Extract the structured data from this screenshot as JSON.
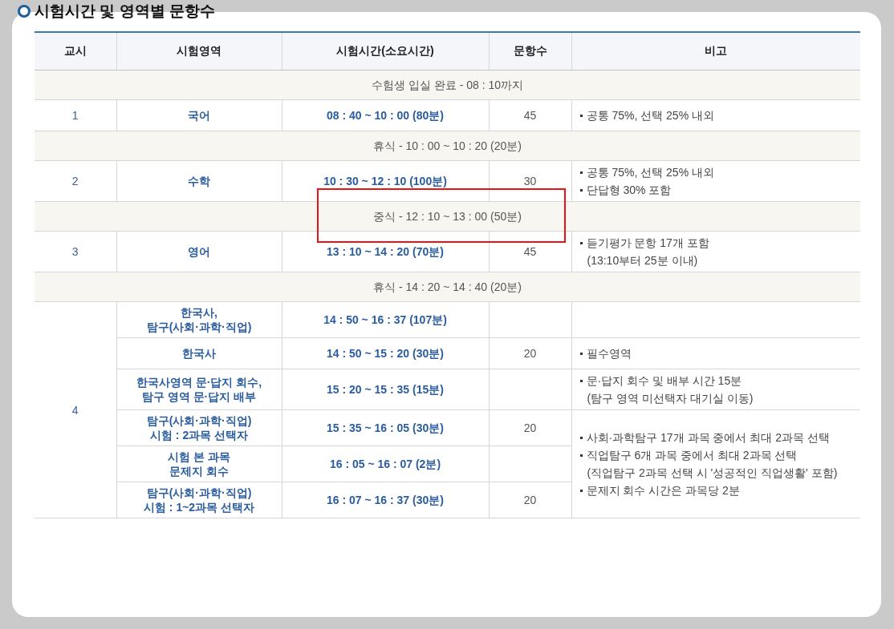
{
  "heading": "시험시간 및 영역별 문항수",
  "columns": [
    "교시",
    "시험영역",
    "시험시간(소요시간)",
    "문항수",
    "비고"
  ],
  "rows": [
    {
      "kind": "break",
      "text": "수험생 입실 완료 - 08 : 10까지",
      "highlighted": false
    },
    {
      "kind": "period",
      "number": "1",
      "sessions": [
        {
          "area": "국어",
          "time": "08 : 40 ~ 10 : 00 (80분)",
          "count": "45",
          "notes": [
            {
              "text": "공통 75%, 선택 25% 내외",
              "bullet": true
            }
          ]
        }
      ]
    },
    {
      "kind": "break",
      "text": "휴식 - 10 : 00 ~ 10 : 20 (20분)",
      "highlighted": false
    },
    {
      "kind": "period",
      "number": "2",
      "sessions": [
        {
          "area": "수학",
          "time": "10 : 30 ~ 12 : 10 (100분)",
          "count": "30",
          "notes": [
            {
              "text": "공통 75%, 선택 25% 내외",
              "bullet": true
            },
            {
              "text": "단답형 30% 포함",
              "bullet": true
            }
          ]
        }
      ]
    },
    {
      "kind": "break",
      "text": "중식 - 12 : 10 ~ 13 : 00 (50분)",
      "highlighted": true
    },
    {
      "kind": "period",
      "number": "3",
      "sessions": [
        {
          "area": "영어",
          "time": "13 : 10 ~ 14 : 20 (70분)",
          "count": "45",
          "notes": [
            {
              "text": "듣기평가 문항 17개 포함",
              "bullet": true
            },
            {
              "text": "(13:10부터 25분 이내)",
              "bullet": false
            }
          ]
        }
      ]
    },
    {
      "kind": "break",
      "text": "휴식 - 14 : 20 ~ 14 : 40 (20분)",
      "highlighted": false
    },
    {
      "kind": "period",
      "number": "4",
      "sessions": [
        {
          "area": "한국사,\n탐구(사회·과학·직업)",
          "time": "14 : 50 ~ 16 : 37 (107분)"
        },
        {
          "area": "한국사",
          "time": "14 : 50 ~ 15 : 20 (30분)",
          "count": "20",
          "notes": [
            {
              "text": "필수영역",
              "bullet": true
            }
          ]
        },
        {
          "area": "한국사영역 문·답지 회수,\n탐구 영역 문·답지 배부",
          "time": "15 : 20 ~ 15 : 35 (15분)",
          "notes": [
            {
              "text": "문·답지 회수 및 배부 시간 15분",
              "bullet": true
            },
            {
              "text": "(탐구 영역 미선택자 대기실 이동)",
              "bullet": false
            }
          ]
        },
        {
          "area": "탐구(사회·과학·직업)\n시험 : 2과목 선택자",
          "time": "15 : 35 ~ 16 : 05 (30분)",
          "count": "20",
          "notes": [
            {
              "text": "사회·과학탐구 17개 과목 중에서 최대 2과목 선택",
              "bullet": true
            },
            {
              "text": "직업탐구 6개 과목 중에서 최대 2과목 선택",
              "bullet": true
            },
            {
              "text": "(직업탐구 2과목 선택 시 '성공적인 직업생활' 포함)",
              "bullet": false
            },
            {
              "text": "문제지 회수 시간은 과목당 2분",
              "bullet": true
            }
          ]
        },
        {
          "area": "시험 본 과목\n문제지 회수",
          "time": "16 : 05 ~ 16 : 07 (2분)",
          "shared_notes": true
        },
        {
          "area": "탐구(사회·과학·직업)\n시험 : 1~2과목 선택자",
          "time": "16 : 07 ~ 16 : 37 (30분)",
          "count": "20",
          "shared_notes": true
        }
      ]
    }
  ]
}
